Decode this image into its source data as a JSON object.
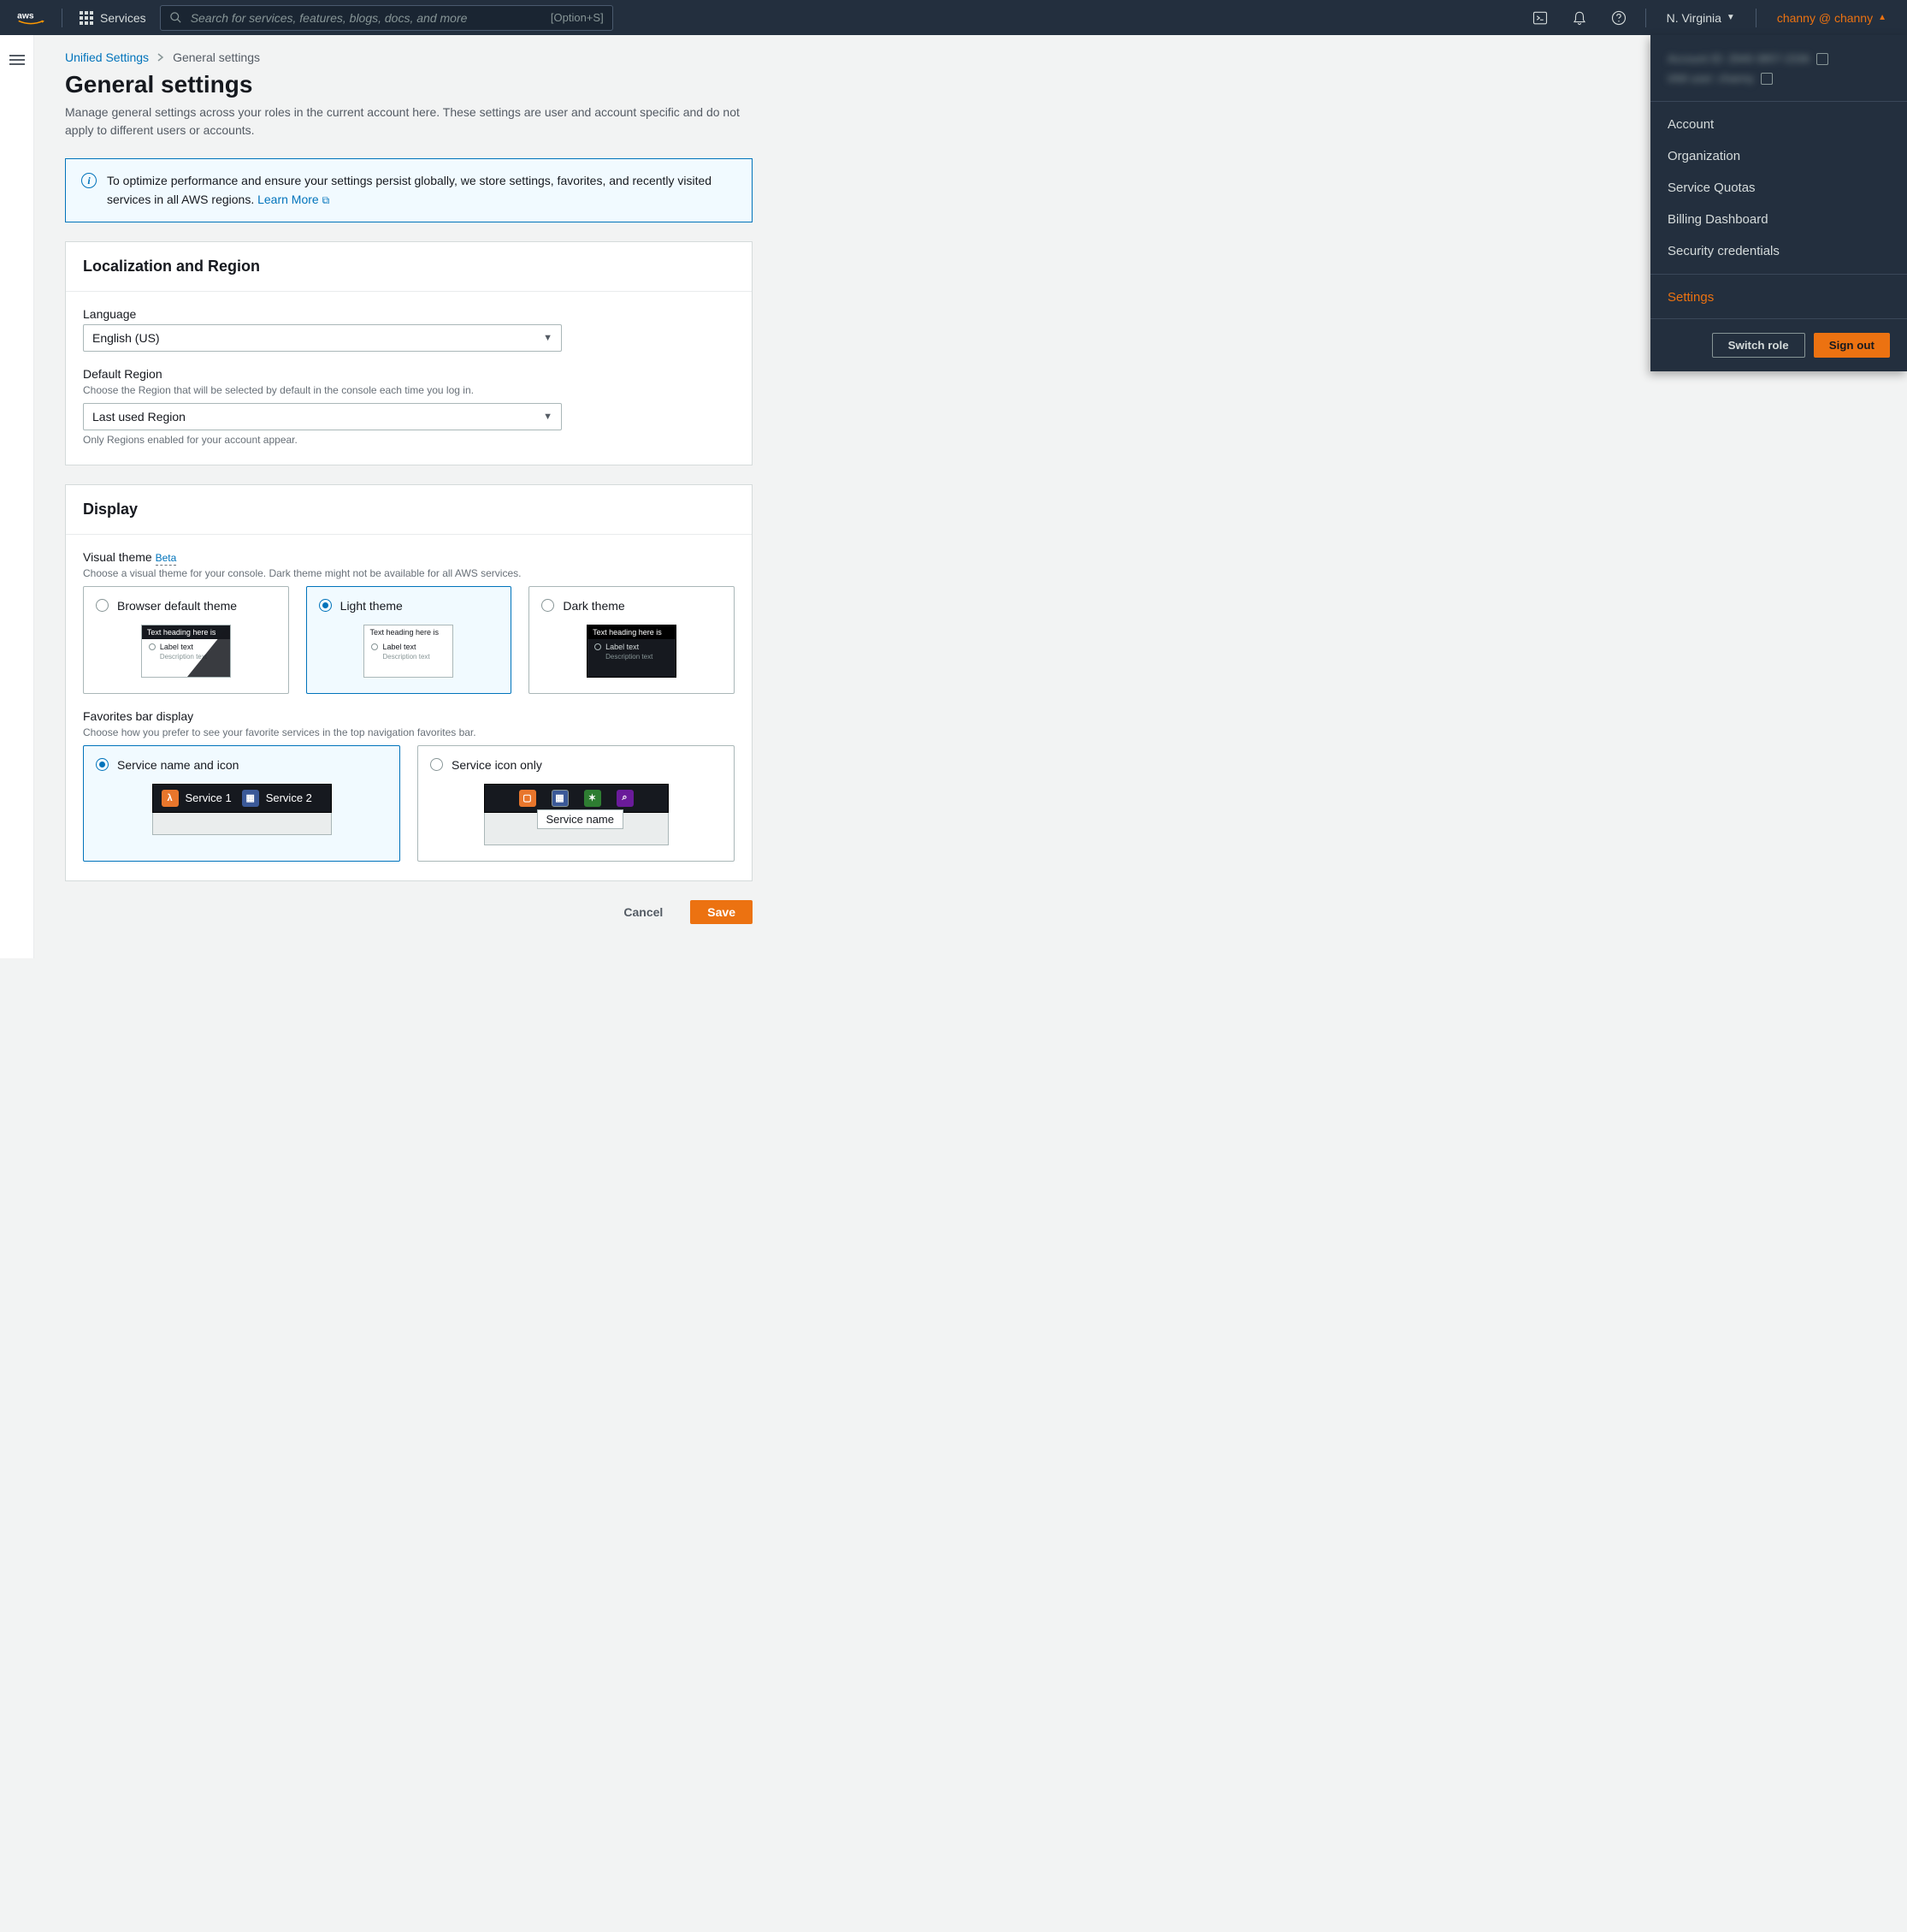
{
  "nav": {
    "services_label": "Services",
    "search_placeholder": "Search for services, features, blogs, docs, and more",
    "search_kbd": "[Option+S]",
    "region": "N. Virginia",
    "account": "channy @ channy"
  },
  "breadcrumb": {
    "root": "Unified Settings",
    "current": "General settings"
  },
  "page": {
    "title": "General settings",
    "subtitle": "Manage general settings across your roles in the current account here. These settings are user and account specific and do not apply to different users or accounts."
  },
  "banner": {
    "text": "To optimize performance and ensure your settings persist globally, we store settings, favorites, and recently visited services in all AWS regions.",
    "learn_more": "Learn More"
  },
  "localization": {
    "heading": "Localization and Region",
    "language_label": "Language",
    "language_value": "English (US)",
    "region_label": "Default Region",
    "region_desc": "Choose the Region that will be selected by default in the console each time you log in.",
    "region_value": "Last used Region",
    "region_hint": "Only Regions enabled for your account appear."
  },
  "display": {
    "heading": "Display",
    "theme_label": "Visual theme",
    "theme_beta": "Beta",
    "theme_desc": "Choose a visual theme for your console. Dark theme might not be available for all AWS services.",
    "themes": {
      "default": "Browser default theme",
      "light": "Light theme",
      "dark": "Dark theme"
    },
    "preview": {
      "heading": "Text heading here is",
      "label": "Label text",
      "desc": "Description text"
    },
    "fav_label": "Favorites bar display",
    "fav_desc": "Choose how you prefer to see your favorite services in the top navigation favorites bar.",
    "fav_options": {
      "name_icon": "Service name and icon",
      "icon_only": "Service icon only"
    },
    "fav_preview": {
      "s1": "Service 1",
      "s2": "Service 2",
      "tooltip": "Service name"
    }
  },
  "actions": {
    "cancel": "Cancel",
    "save": "Save"
  },
  "acct_menu": {
    "acct_id_label": "Account ID:",
    "acct_id_value": "2940-3857-2336",
    "iam_label": "IAM user:",
    "iam_value": "channy",
    "items": {
      "account": "Account",
      "organization": "Organization",
      "quotas": "Service Quotas",
      "billing": "Billing Dashboard",
      "security": "Security credentials",
      "settings": "Settings"
    },
    "switch_role": "Switch role",
    "sign_out": "Sign out"
  }
}
